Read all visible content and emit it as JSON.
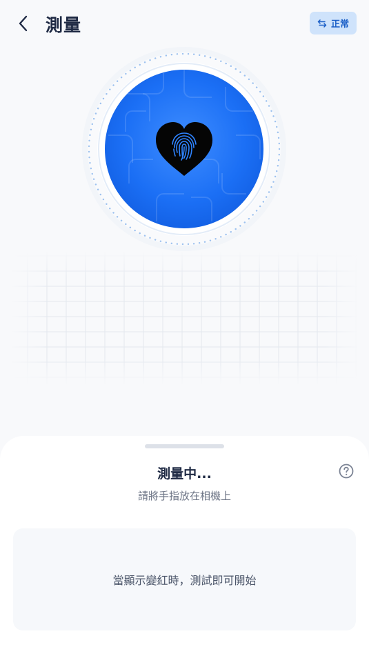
{
  "header": {
    "title": "測量",
    "mode_label": "正常"
  },
  "measure": {
    "status_title": "測量中...",
    "instruction": "請將手指放在相機上",
    "hint": "當顯示變紅時，測試即可開始"
  },
  "icons": {
    "back": "chevron-left-icon",
    "mode": "swap-arrows-icon",
    "heart": "heart-icon",
    "fingerprint": "fingerprint-icon",
    "help": "question-circle-icon"
  },
  "colors": {
    "accent": "#1b6ff5",
    "accent_light": "#cfe3fb",
    "title": "#1f2a44",
    "muted": "#6b7384",
    "background": "#f8f9fb"
  }
}
